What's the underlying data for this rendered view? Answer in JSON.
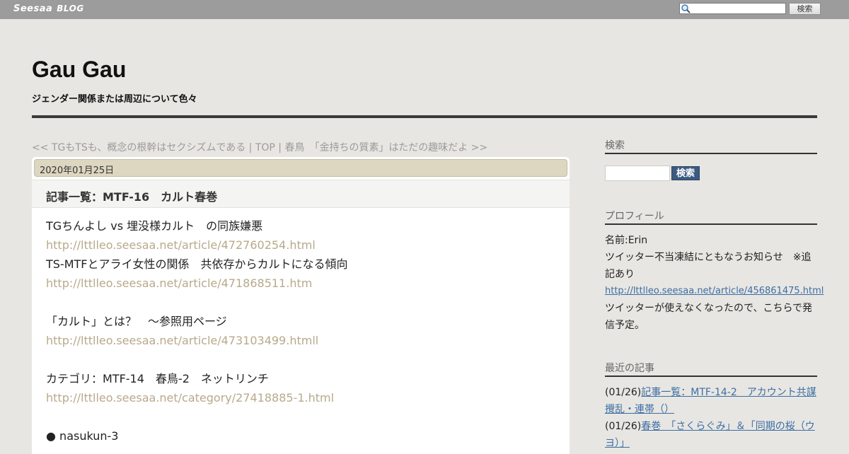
{
  "topbar": {
    "logo_main": "Seesaa",
    "logo_blog": "BLOG",
    "search_value": "",
    "search_button": "検索"
  },
  "header": {
    "title": "Gau Gau",
    "description": "ジェンダー関係または周辺について色々"
  },
  "nav": {
    "prev": "<< TGもTSも、概念の根幹はセクシズムである",
    "sep1": " | ",
    "top": "TOP",
    "sep2": " | ",
    "next": "春鳥　「金持ちの質素」はただの趣味だよ >>"
  },
  "article": {
    "date": "2020年01月25日",
    "title": "記事一覧：MTF-16　カルト春巻",
    "lines": [
      {
        "text": "TGちんよし vs 埋没様カルト　の同族嫌悪",
        "link": false
      },
      {
        "text": "http://lttlleo.seesaa.net/article/472760254.html",
        "link": true
      },
      {
        "text": "TS-MTFとアライ女性の関係　共依存からカルトになる傾向",
        "link": false
      },
      {
        "text": "http://lttlleo.seesaa.net/article/471868511.htm",
        "link": true
      },
      {
        "text": "",
        "link": false
      },
      {
        "text": "「カルト」とは？　～参照用ページ",
        "link": false
      },
      {
        "text": "http://lttlleo.seesaa.net/article/473103499.htmll",
        "link": true
      },
      {
        "text": "",
        "link": false
      },
      {
        "text": "カテゴリ：MTF-14　春鳥-2　ネットリンチ",
        "link": false
      },
      {
        "text": "http://lttlleo.seesaa.net/category/27418885-1.html",
        "link": true
      },
      {
        "text": "",
        "link": false
      },
      {
        "text": "● nasukun-3",
        "link": false
      }
    ]
  },
  "sidebar": {
    "search_heading": "検索",
    "search_value": "",
    "search_button": "検索",
    "profile_heading": "プロフィール",
    "profile_name": "名前:Erin",
    "profile_notice": "ツイッター不当凍結にともなうお知らせ　※追記あり",
    "profile_link": "http://lttlleo.seesaa.net/article/456861475.html",
    "profile_note": "ツイッターが使えなくなったので、こちらで発信予定。",
    "recent_heading": "最近の記事",
    "recent": [
      {
        "date": "(01/26)",
        "title": "記事一覧：MTF-14-2　アカウント共謀攪乱・連帯（）"
      },
      {
        "date": "(01/26)",
        "title": "春巻　「さくらぐみ」＆「同期の桜（ウヨ）」"
      }
    ]
  },
  "colors": {
    "topbar": "#9c9c9c",
    "background": "#e8e6e2",
    "date_bar": "#ddd7c1",
    "article_link": "#b8a98a",
    "sidebar_link": "#3b6ea5",
    "sidebar_button": "#3d5a80"
  }
}
